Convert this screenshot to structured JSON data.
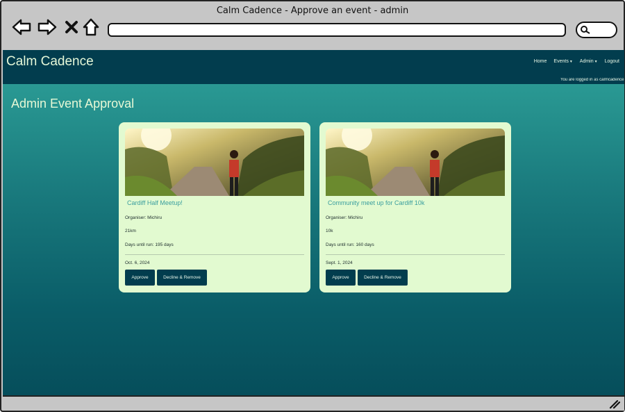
{
  "window": {
    "title": "Calm Cadence - Approve an event - admin"
  },
  "site": {
    "brand": "Calm Cadence",
    "nav": [
      {
        "label": "Home",
        "dropdown": false
      },
      {
        "label": "Events",
        "dropdown": true
      },
      {
        "label": "Admin",
        "dropdown": true
      },
      {
        "label": "Logout",
        "dropdown": false
      }
    ],
    "login_status": "You are logged in as calmcadence"
  },
  "page": {
    "heading": "Admin Event Approval"
  },
  "events": [
    {
      "title": "Cardiff Half Meetup!",
      "organiser": "Organiser: Michiru",
      "distance": "21km",
      "days_until": "Days until run: 195 days",
      "date": "Oct. 6, 2024",
      "approve_label": "Approve",
      "decline_label": "Decline & Remove"
    },
    {
      "title": "Community meet up for Cardiff 10k",
      "organiser": "Organiser: Michiru",
      "distance": "10k",
      "days_until": "Days until run: 160 days",
      "date": "Sept. 1, 2024",
      "approve_label": "Approve",
      "decline_label": "Decline & Remove"
    }
  ],
  "colors": {
    "navbar": "#023d4e",
    "card_bg": "#e2fad0",
    "title_accent": "#3a9e9e",
    "button": "#023d4e"
  },
  "icons": [
    "back-arrow-icon",
    "forward-arrow-icon",
    "close-x-icon",
    "home-icon",
    "search-icon",
    "resize-grip-icon"
  ]
}
